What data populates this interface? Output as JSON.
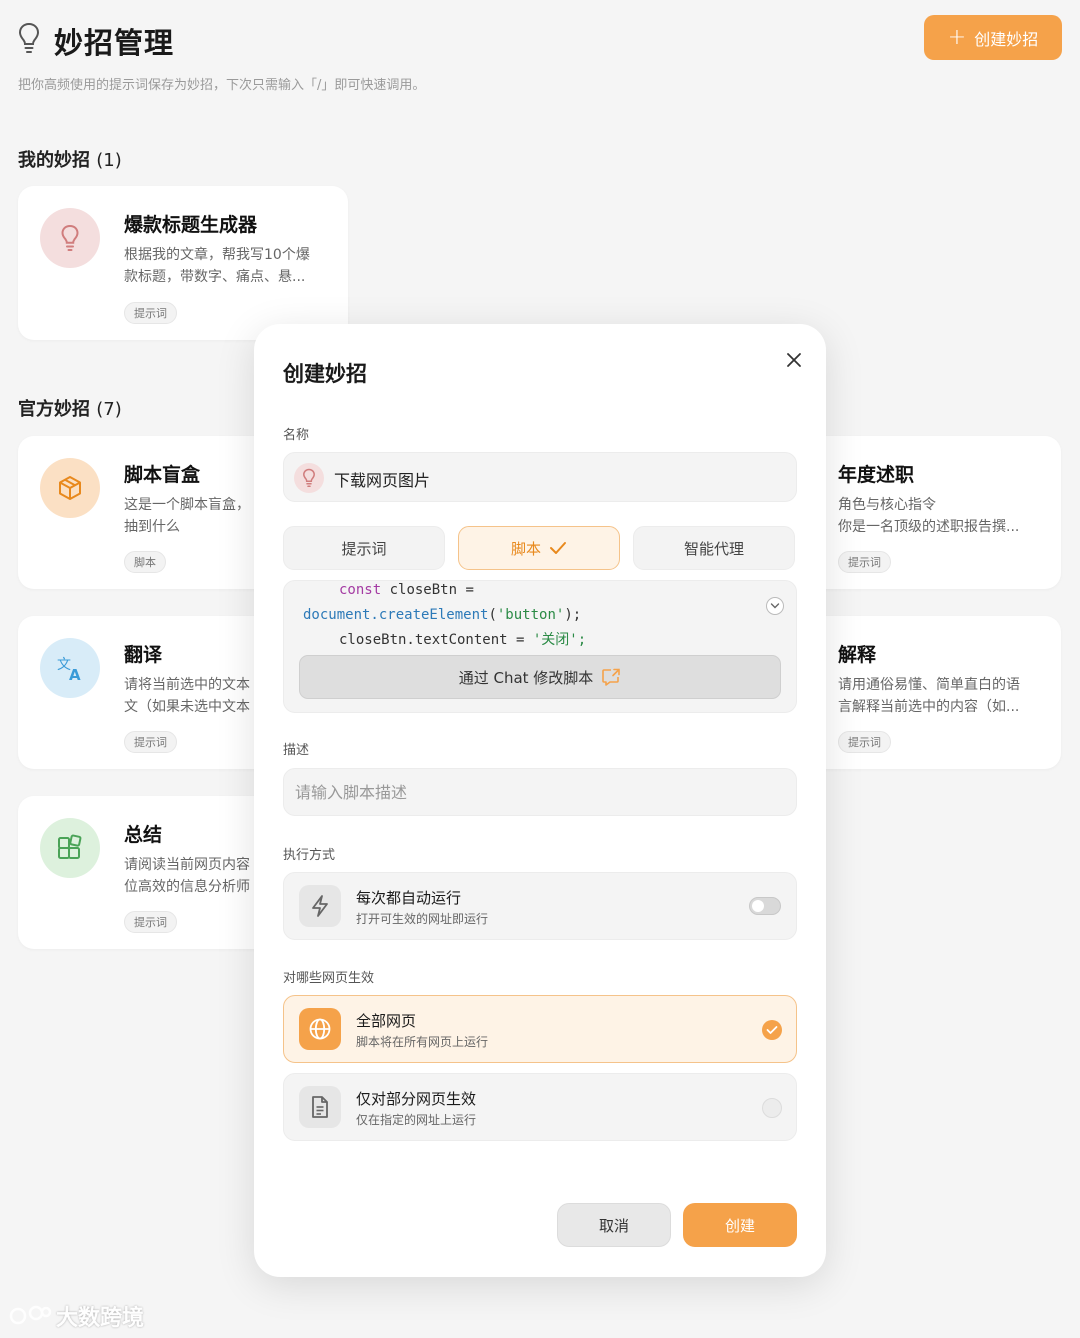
{
  "header": {
    "title": "妙招管理",
    "subtitle": "把你高频使用的提示词保存为妙招，下次只需输入「/」即可快速调用。",
    "create_button": "创建妙招"
  },
  "my_section": {
    "title": "我的妙招",
    "count": "(1)"
  },
  "official_section": {
    "title": "官方妙招",
    "count": "(7)"
  },
  "my_cards": [
    {
      "title": "爆款标题生成器",
      "desc1": "根据我的文章，帮我写10个爆",
      "desc2": "款标题，带数字、痛点、悬...",
      "tag": "提示词",
      "icon": "bulb-icon"
    }
  ],
  "official_cards": [
    {
      "title": "脚本盲盒",
      "desc1": "这是一个脚本盲盒，",
      "desc2": "抽到什么",
      "tag": "脚本",
      "icon": "cube-icon"
    },
    {
      "title": "年度述职",
      "desc1": "角色与核心指令",
      "desc2": "你是一名顶级的述职报告撰...",
      "tag": "提示词",
      "icon": "none"
    },
    {
      "title": "翻译",
      "desc1": "请将当前选中的文本",
      "desc2": "文（如果未选中文本",
      "tag": "提示词",
      "icon": "translate-icon"
    },
    {
      "title": "解释",
      "desc1": "请用通俗易懂、简单直白的语",
      "desc2": "言解释当前选中的内容（如...",
      "tag": "提示词",
      "icon": "none"
    },
    {
      "title": "总结",
      "desc1": "请阅读当前网页内容",
      "desc2": "位高效的信息分析师",
      "tag": "提示词",
      "icon": "grid-icon"
    }
  ],
  "modal": {
    "title": "创建妙招",
    "name_label": "名称",
    "name_value": "下载网页图片",
    "tabs": [
      "提示词",
      "脚本",
      "智能代理"
    ],
    "active_tab": "脚本",
    "code": {
      "l1_kw": "const",
      "l1_rest": " closeBtn =",
      "l2_obj": "document.",
      "l2_fn": "createElement",
      "l2_p1": "(",
      "l2_str": "'button'",
      "l2_p2": ");",
      "l3_rest": "closeBtn.textContent = ",
      "l3_str": "'关闭';"
    },
    "chat_button": "通过 Chat 修改脚本",
    "desc_label": "描述",
    "desc_placeholder": "请输入脚本描述",
    "exec_label": "执行方式",
    "auto_run": {
      "title": "每次都自动运行",
      "sub": "打开可生效的网址即运行",
      "enabled": false
    },
    "scope_label": "对哪些网页生效",
    "scope_all": {
      "title": "全部网页",
      "sub": "脚本将在所有网页上运行",
      "selected": true
    },
    "scope_some": {
      "title": "仅对部分网页生效",
      "sub": "仅在指定的网址上运行",
      "selected": false
    },
    "cancel": "取消",
    "create": "创建"
  },
  "watermark": "大数跨境",
  "colors": {
    "accent": "#f5a24a",
    "accent_soft": "#fef3e6"
  }
}
